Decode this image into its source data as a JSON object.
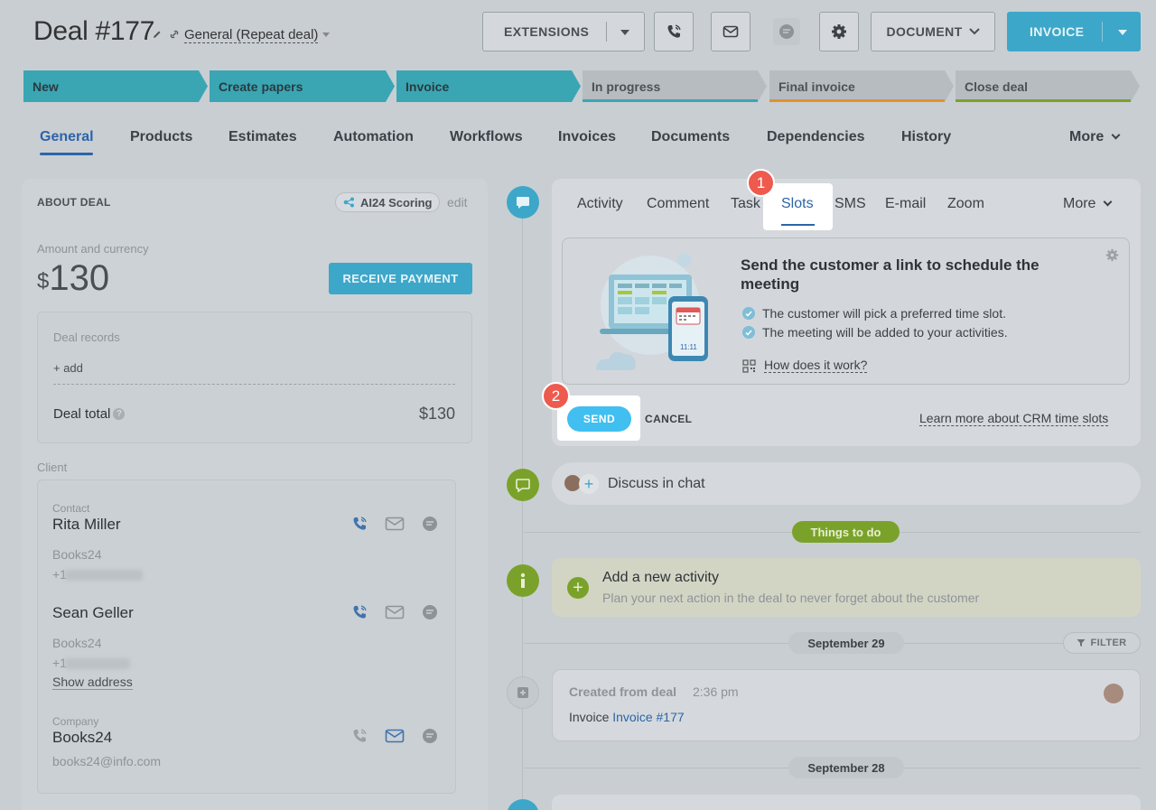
{
  "header": {
    "title": "Deal #177",
    "category": "General (Repeat deal)",
    "buttons": {
      "extensions": "EXTENSIONS",
      "document": "DOCUMENT",
      "invoice": "INVOICE"
    }
  },
  "stages": [
    {
      "label": "New",
      "state": "done"
    },
    {
      "label": "Create papers",
      "state": "done"
    },
    {
      "label": "Invoice",
      "state": "done"
    },
    {
      "label": "In progress",
      "state": "todo",
      "color": "#3aa6b3"
    },
    {
      "label": "Final invoice",
      "state": "todo",
      "color": "#e2912b"
    },
    {
      "label": "Close deal",
      "state": "todo",
      "color": "#7aa22a"
    }
  ],
  "tabs": [
    "General",
    "Products",
    "Estimates",
    "Automation",
    "Workflows",
    "Invoices",
    "Documents",
    "Dependencies",
    "History",
    "More"
  ],
  "about": {
    "heading": "ABOUT DEAL",
    "scoring": "AI24 Scoring",
    "edit": "edit",
    "amount_label": "Amount and currency",
    "currency": "$",
    "amount": "130",
    "receive_button": "RECEIVE PAYMENT",
    "records_label": "Deal records",
    "add": "+ add",
    "deal_total_label": "Deal total",
    "deal_total_value": "$130",
    "client_label": "Client"
  },
  "client": {
    "contact_label": "Contact",
    "contacts": [
      {
        "name": "Rita Miller",
        "company": "Books24",
        "phone": "+1"
      },
      {
        "name": "Sean Geller",
        "company": "Books24",
        "phone": "+1",
        "show_address": "Show address"
      }
    ],
    "company_label": "Company",
    "company_name": "Books24",
    "company_email": "books24@info.com"
  },
  "editor": {
    "tabs": [
      "Activity",
      "Comment",
      "Task",
      "Slots",
      "SMS",
      "E-mail",
      "Zoom",
      "More"
    ],
    "active_tab": "Slots",
    "badge1": "1",
    "badge2": "2",
    "title": "Send the customer a link to schedule the meeting",
    "check1": "The customer will pick a preferred time slot.",
    "check2": "The meeting will be added to your activities.",
    "how": "How does it work?",
    "phone_time": "11:11",
    "send": "SEND",
    "cancel": "CANCEL",
    "learn_more": "Learn more about CRM time slots"
  },
  "timeline": {
    "discuss": "Discuss in chat",
    "things_to_do": "Things to do",
    "add_activity_title": "Add a new activity",
    "add_activity_sub": "Plan your next action in the deal to never forget about the customer",
    "filter": "FILTER",
    "date1": "September 29",
    "created_title": "Created from deal",
    "created_time": "2:36 pm",
    "created_prefix": "Invoice",
    "created_link": "Invoice #177",
    "date2": "September 28"
  },
  "colors": {
    "accent": "#3da7c9",
    "link": "#2c64a8",
    "badge": "#ee5a4e",
    "send": "#40bff0",
    "green": "#7aa22a"
  }
}
